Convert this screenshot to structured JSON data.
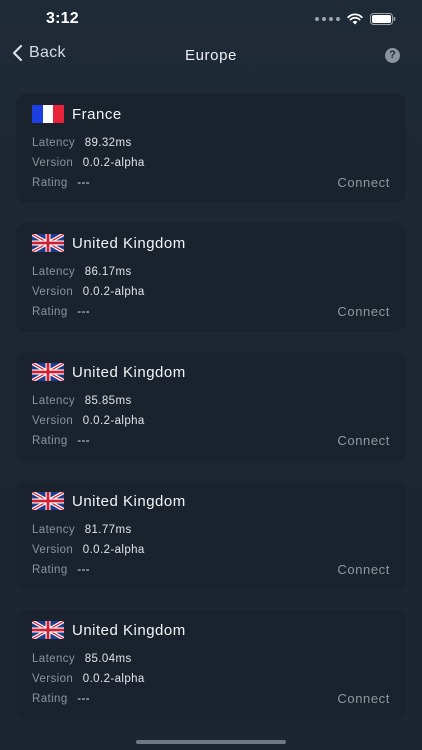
{
  "status_bar": {
    "time": "3:12",
    "icons": [
      "signal-dots-icon",
      "wifi-icon",
      "battery-icon"
    ]
  },
  "nav": {
    "back_label": "Back",
    "title": "Europe",
    "help_label": "?"
  },
  "labels": {
    "latency": "Latency",
    "version": "Version",
    "rating": "Rating",
    "connect": "Connect"
  },
  "servers": [
    {
      "country": "France",
      "flag": "france-flag-icon",
      "latency": "89.32ms",
      "version": "0.0.2-alpha",
      "rating": "---"
    },
    {
      "country": "United Kingdom",
      "flag": "uk-flag-icon",
      "latency": "86.17ms",
      "version": "0.0.2-alpha",
      "rating": "---"
    },
    {
      "country": "United Kingdom",
      "flag": "uk-flag-icon",
      "latency": "85.85ms",
      "version": "0.0.2-alpha",
      "rating": "---"
    },
    {
      "country": "United Kingdom",
      "flag": "uk-flag-icon",
      "latency": "81.77ms",
      "version": "0.0.2-alpha",
      "rating": "---"
    },
    {
      "country": "United Kingdom",
      "flag": "uk-flag-icon",
      "latency": "85.04ms",
      "version": "0.0.2-alpha",
      "rating": "---"
    }
  ],
  "colors": {
    "background": "#1f2a37",
    "card": "#1a232d",
    "label": "#8b949d",
    "value": "#dfe3e7",
    "connect": "#8f979f"
  }
}
